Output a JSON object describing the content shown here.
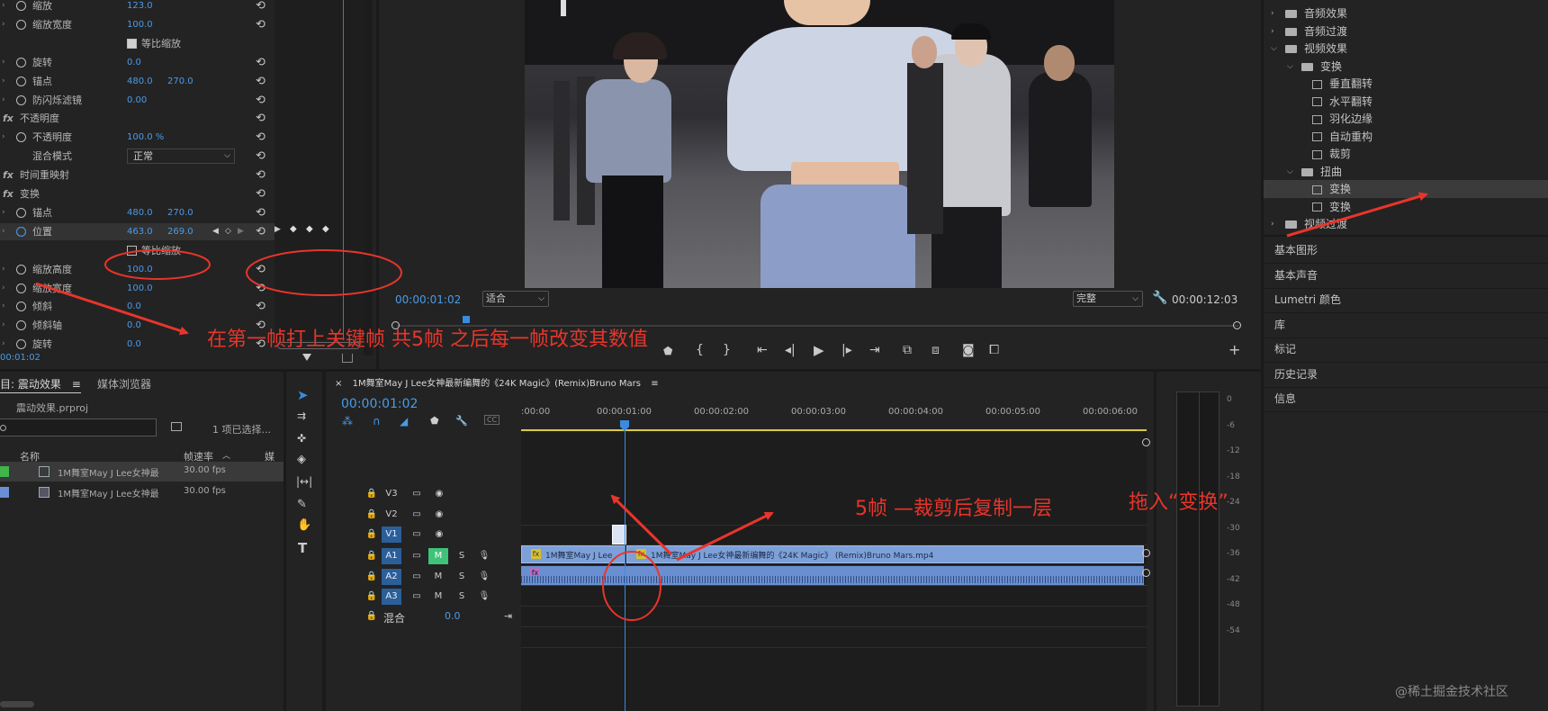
{
  "effect_controls": {
    "rows": [
      {
        "label": "缩放",
        "v1": "123.0"
      },
      {
        "label": "缩放宽度",
        "v1": "100.0"
      },
      {
        "label": "等比缩放"
      },
      {
        "label": "旋转",
        "v1": "0.0"
      },
      {
        "label": "锚点",
        "v1": "480.0",
        "v2": "270.0"
      },
      {
        "label": "防闪烁滤镜",
        "v1": "0.00"
      },
      {
        "label": "不透明度"
      },
      {
        "label": "不透明度",
        "v1": "100.0 %"
      },
      {
        "label": "混合模式",
        "v1": "正常"
      },
      {
        "label": "时间重映射"
      },
      {
        "label": "变换"
      },
      {
        "label": "锚点",
        "v1": "480.0",
        "v2": "270.0"
      },
      {
        "label": "位置",
        "v1": "463.0",
        "v2": "269.0"
      },
      {
        "label": "等比缩放"
      },
      {
        "label": "缩放高度",
        "v1": "100.0"
      },
      {
        "label": "缩放宽度",
        "v1": "100.0"
      },
      {
        "label": "倾斜",
        "v1": "0.0"
      },
      {
        "label": "倾斜轴",
        "v1": "0.0"
      },
      {
        "label": "旋转",
        "v1": "0.0"
      }
    ],
    "timecode": "00:01:02"
  },
  "project": {
    "tab_title": "目: 震动效果",
    "tab_media": "媒体浏览器",
    "file": "震动效果.prproj",
    "selection_info": "1 项已选择...",
    "col_name": "名称",
    "col_fps": "帧速率",
    "col_more": "媒",
    "items": [
      {
        "name": "1M舞室May J Lee女神最",
        "fps": "30.00 fps",
        "color": "#3fb54a"
      },
      {
        "name": "1M舞室May J Lee女神最",
        "fps": "30.00 fps",
        "color": "#6b8fd6"
      }
    ]
  },
  "monitor": {
    "timecode_left": "00:00:01:02",
    "fit": "适合",
    "quality": "完整",
    "timecode_right": "00:00:12:03"
  },
  "timeline": {
    "tab_title": "1M舞室May J Lee女神最新编舞的《24K Magic》(Remix)Bruno Mars",
    "timecode": "00:00:01:02",
    "ruler": [
      ":00:00",
      "00:00:01:00",
      "00:00:02:00",
      "00:00:03:00",
      "00:00:04:00",
      "00:00:05:00",
      "00:00:06:00"
    ],
    "tracks_video": [
      "V3",
      "V2",
      "V1"
    ],
    "tracks_audio": [
      "A1",
      "A2",
      "A3"
    ],
    "mix_label": "混合",
    "mix_value": "0.0",
    "clip_small": "1M舞室May J Lee",
    "clip_main": "1M舞室May J Lee女神最新编舞的《24K Magic》 (Remix)Bruno Mars.mp4",
    "meter_ticks": [
      "0",
      "-6",
      "-12",
      "-18",
      "-24",
      "-30",
      "-36",
      "-42",
      "-48",
      "-54"
    ]
  },
  "effects_panel": {
    "items": [
      {
        "label": "音频效果",
        "indent": 0,
        "type": "folder",
        "open": false
      },
      {
        "label": "音频过渡",
        "indent": 0,
        "type": "folder",
        "open": false
      },
      {
        "label": "视频效果",
        "indent": 0,
        "type": "folder",
        "open": true
      },
      {
        "label": "变换",
        "indent": 1,
        "type": "folder",
        "open": true
      },
      {
        "label": "垂直翻转",
        "indent": 2,
        "type": "preset"
      },
      {
        "label": "水平翻转",
        "indent": 2,
        "type": "preset"
      },
      {
        "label": "羽化边缘",
        "indent": 2,
        "type": "preset"
      },
      {
        "label": "自动重构",
        "indent": 2,
        "type": "preset"
      },
      {
        "label": "裁剪",
        "indent": 2,
        "type": "preset"
      },
      {
        "label": "扭曲",
        "indent": 1,
        "type": "folder",
        "open": true
      },
      {
        "label": "变换",
        "indent": 2,
        "type": "preset",
        "selected": true
      },
      {
        "label": "变换",
        "indent": 2,
        "type": "preset"
      },
      {
        "label": "视频过渡",
        "indent": 0,
        "type": "folder",
        "open": false
      }
    ],
    "sections": [
      "基本图形",
      "基本声音",
      "Lumetri 颜色",
      "库",
      "标记",
      "历史记录",
      "信息"
    ]
  },
  "annotations": {
    "keyframe_note": "在第一帧打上关键帧 共5帧 之后每一帧改变其数值",
    "cut_note": "5帧 —裁剪后复制一层",
    "drag_note": "拖入“变换”"
  },
  "watermark": "@稀土掘金技术社区"
}
